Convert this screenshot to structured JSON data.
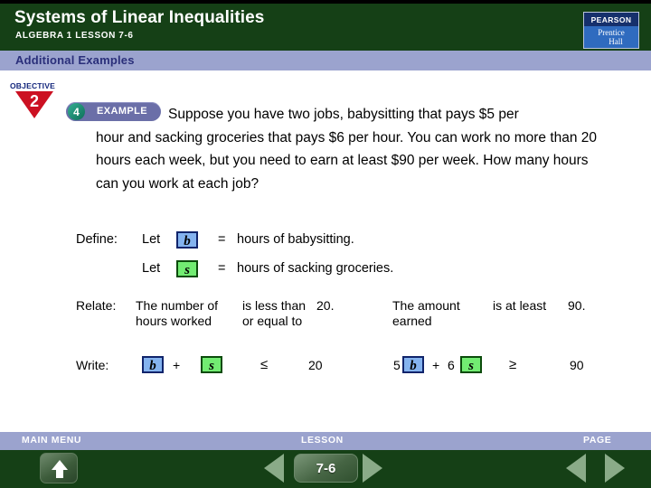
{
  "header": {
    "title": "Systems of Linear Inequalities",
    "subtitle": "ALGEBRA 1  LESSON 7-6",
    "logo": {
      "top_text": "PEARSON",
      "line1": "Prentice",
      "line2": "Hall"
    },
    "section_label": "Additional Examples",
    "colors": {
      "header_green": "#154016",
      "lavender": "#9ba3ce",
      "logo_blue": "#2f6bbf",
      "objective_red": "#cc1122"
    }
  },
  "objective": {
    "word": "OBJECTIVE",
    "number": "2"
  },
  "example": {
    "number": "4",
    "label": "EXAMPLE"
  },
  "problem": {
    "line1": "Suppose you have two jobs, babysitting that pays $5 per",
    "rest": "hour and sacking groceries that pays $6 per hour. You can work no more than 20 hours each week, but you need to earn at least $90 per week. How many hours can you work at each job?"
  },
  "define": {
    "label": "Define:",
    "let": "Let",
    "equals": "=",
    "var_b": "b",
    "var_s": "s",
    "desc_b": "hours of babysitting.",
    "desc_s": "hours of sacking groceries."
  },
  "relate": {
    "label": "Relate:",
    "cells": [
      "The number of hours worked",
      "is less than or equal to",
      "20.",
      "The amount earned",
      "is at least",
      "90."
    ]
  },
  "write": {
    "label": "Write:",
    "var_b": "b",
    "var_s": "s",
    "plus1": "+",
    "plus2": "+",
    "le": "≤",
    "ge": "≥",
    "twenty": "20",
    "ninety": "90",
    "coef5": "5",
    "coef6": "6"
  },
  "footer": {
    "main_menu": "MAIN MENU",
    "lesson": "LESSON",
    "page": "PAGE",
    "lesson_number": "7-6"
  }
}
